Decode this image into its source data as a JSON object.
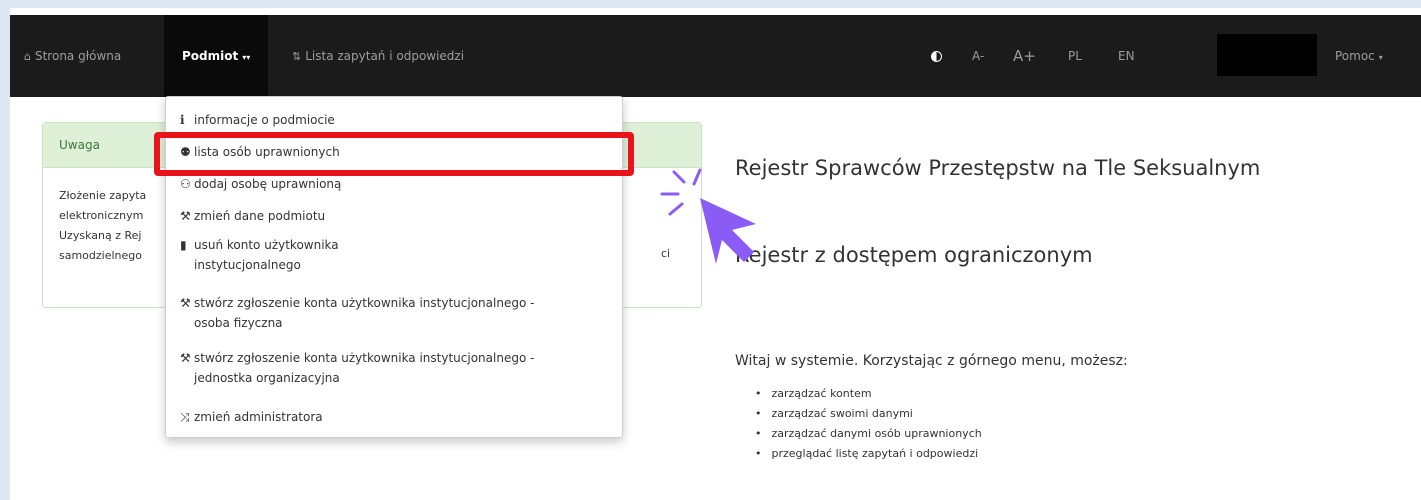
{
  "navbar": {
    "home": "Strona główna",
    "home_icon": "home-icon",
    "podmiot": "Podmiot",
    "podmiot_caret": "▾▾",
    "lista": "Lista zapytań i odpowiedzi",
    "lista_icon": "sort-icon",
    "font_decrease": "A-",
    "font_increase": "A+",
    "lang_pl": "PL",
    "lang_en": "EN",
    "help": "Pomoc",
    "help_caret": "▾"
  },
  "dropdown": {
    "items": [
      {
        "label": "informacje o podmiocie",
        "icon": "info-icon"
      },
      {
        "label": "lista osób uprawnionych",
        "icon": "users-icon"
      },
      {
        "label": "dodaj osobę uprawnioną",
        "icon": "add-user-icon"
      },
      {
        "label": "zmień dane podmiotu",
        "icon": "gavel-icon"
      },
      {
        "label": "usuń konto użytkownika",
        "label2": "instytucjonalnego",
        "icon": "trash-icon"
      },
      {
        "label": "stwórz zgłoszenie konta użytkownika instytucjonalnego -",
        "label2": "osoba fizyczna",
        "icon": "gavel-icon"
      },
      {
        "label": "stwórz zgłoszenie konta użytkownika instytucjonalnego -",
        "label2": "jednostka organizacyjna",
        "icon": "gavel-icon"
      },
      {
        "label": "zmień administratora",
        "icon": "shuffle-icon"
      }
    ]
  },
  "alert": {
    "heading": "Uwaga",
    "lines": [
      "Złożenie zapyta",
      "elektronicznym",
      "Uzyskaną z Rej",
      "samodzielnego"
    ],
    "trailing": "ci"
  },
  "main": {
    "title1": "Rejestr Sprawców Przestępstw na Tle Seksualnym",
    "title2": "Rejestr z dostępem ograniczonym",
    "welcome": "Witaj w systemie. Korzystając z górnego menu, możesz:",
    "bullets": [
      "zarządzać kontem",
      "zarządzać swoimi danymi",
      "zarządzać danymi osób uprawnionych",
      "przeglądać listę zapytań i odpowiedzi"
    ]
  },
  "colors": {
    "navbar": "#1b1b1b",
    "highlight": "#e8131b",
    "cursor": "#8a5cf5",
    "alert_heading_bg": "#dff0d8"
  }
}
